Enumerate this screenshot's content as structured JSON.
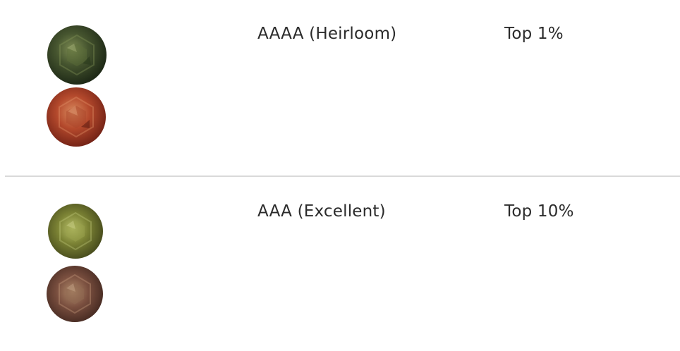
{
  "grades": [
    {
      "grade": "AAAA (Heirloom)",
      "rarity": "Top 1%",
      "gem_icons": [
        "gem-green-icon",
        "gem-red-icon"
      ],
      "colors": {
        "daylight": "#3f4f2c",
        "incandescent": "#b24a2c"
      }
    },
    {
      "grade": "AAA (Excellent)",
      "rarity": "Top 10%",
      "gem_icons": [
        "gem-olive-icon",
        "gem-mauve-icon"
      ],
      "colors": {
        "daylight": "#7a8232",
        "incandescent": "#7a4e3e"
      }
    }
  ]
}
